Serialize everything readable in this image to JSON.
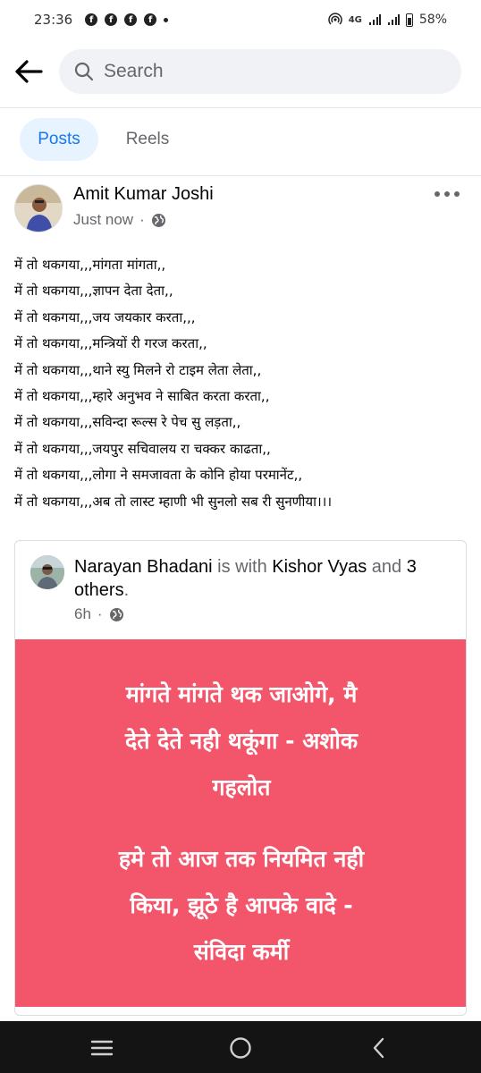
{
  "status_bar": {
    "time": "23:36",
    "network": "4G",
    "battery": "58%"
  },
  "search": {
    "placeholder": "Search"
  },
  "tabs": [
    {
      "label": "Posts",
      "active": true
    },
    {
      "label": "Reels",
      "active": false
    }
  ],
  "post": {
    "author": "Amit Kumar Joshi",
    "time": "Just now",
    "lines": [
      "में तो थकगया,,,मांगता मांगता,,",
      "में तो थकगया,,,ज्ञापन देता देता,,",
      "में तो थकगया,,,जय जयकार करता,,,",
      "में तो थकगया,,,मन्त्रियों री गरज करता,,",
      "में तो थकगया,,,थाने स्यु मिलने रो टाइम लेता लेता,,",
      "में तो थकगया,,,म्हारे अनुभव ने साबित करता करता,,",
      "में तो थकगया,,,सविन्दा रूल्स रे पेच सु लड़ता,,",
      "में तो थकगया,,,जयपुर सचिवालय रा चक्कर काढता,,",
      "में तो थकगया,,,लोगा ने समजावता के कोनि होया परमानेंट,,",
      "में तो थकगया,,,अब तो लास्ट म्हाणी भी सुनलो सब री सुनणीया।।।"
    ]
  },
  "shared_post": {
    "author": "Narayan Bhadani",
    "with_text": "is with",
    "tagged": "Kishor Vyas",
    "and_text": "and",
    "others": "3 others",
    "period": ".",
    "time": "6h",
    "banner_color": "#f3566b",
    "banner_lines_1": [
      "मांगते मांगते थक जाओगे, मै",
      "देते देते नही थकूंगा - अशोक",
      "गहलोत"
    ],
    "banner_lines_2": [
      "हमे तो आज तक नियमित नही",
      "किया, झूठे है आपके वादे -",
      "संविदा कर्मी"
    ]
  },
  "colors": {
    "accent": "#1877f2",
    "tab_active_bg": "#e7f3ff",
    "secondary_text": "#65676b"
  }
}
